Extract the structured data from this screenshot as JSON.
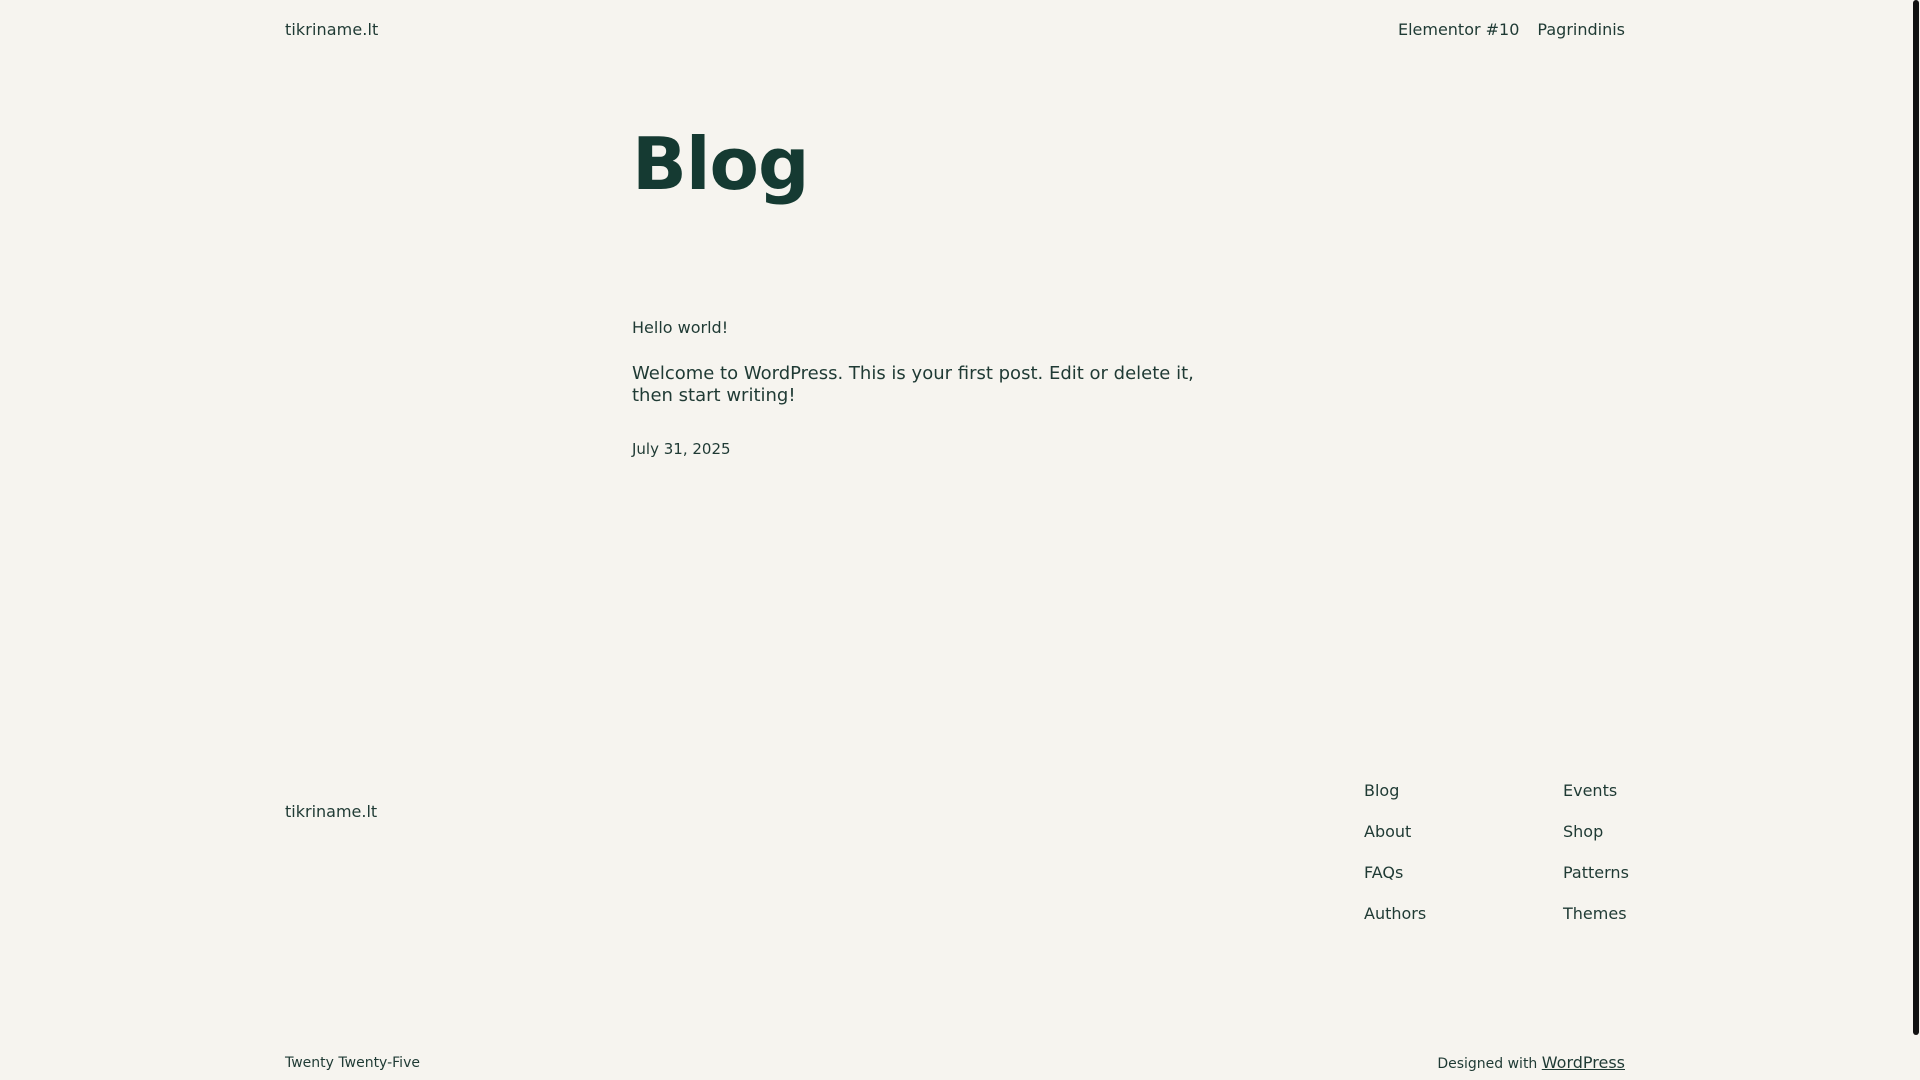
{
  "header": {
    "site_title": "tikriname.lt",
    "nav": [
      "Elementor #10",
      "Pagrindinis"
    ]
  },
  "main": {
    "page_title": "Blog",
    "post": {
      "title": "Hello world!",
      "excerpt": "Welcome to WordPress. This is your first post. Edit or delete it, then start writing!",
      "date": "July 31, 2025"
    }
  },
  "footer": {
    "site_title": "tikriname.lt",
    "col1": [
      "Blog",
      "About",
      "FAQs",
      "Authors"
    ],
    "col2": [
      "Events",
      "Shop",
      "Patterns",
      "Themes"
    ],
    "theme_name": "Twenty Twenty-Five",
    "designed_with": "Designed with",
    "wordpress_link": "WordPress"
  }
}
